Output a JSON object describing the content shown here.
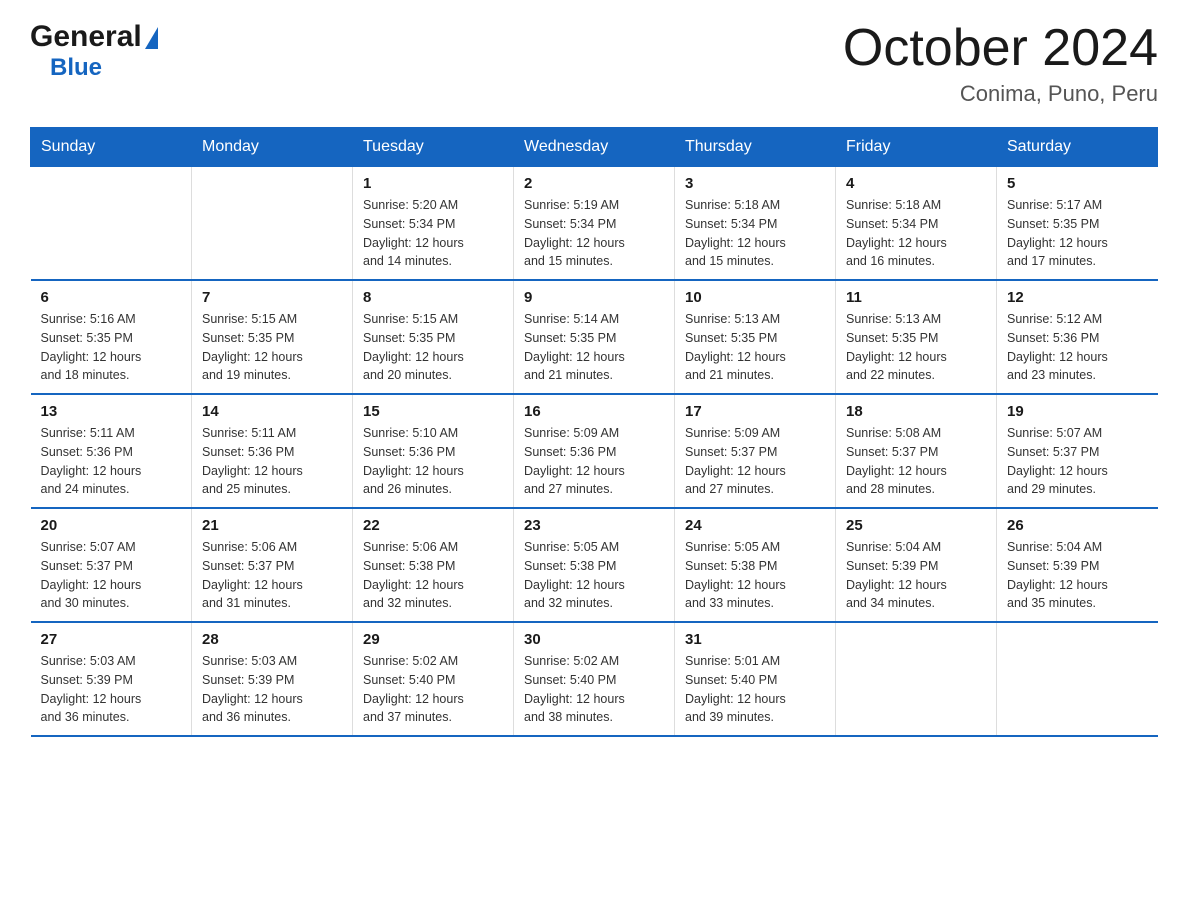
{
  "logo": {
    "general": "General",
    "blue": "Blue"
  },
  "title": "October 2024",
  "subtitle": "Conima, Puno, Peru",
  "headers": [
    "Sunday",
    "Monday",
    "Tuesday",
    "Wednesday",
    "Thursday",
    "Friday",
    "Saturday"
  ],
  "weeks": [
    [
      {
        "day": "",
        "info": ""
      },
      {
        "day": "",
        "info": ""
      },
      {
        "day": "1",
        "info": "Sunrise: 5:20 AM\nSunset: 5:34 PM\nDaylight: 12 hours\nand 14 minutes."
      },
      {
        "day": "2",
        "info": "Sunrise: 5:19 AM\nSunset: 5:34 PM\nDaylight: 12 hours\nand 15 minutes."
      },
      {
        "day": "3",
        "info": "Sunrise: 5:18 AM\nSunset: 5:34 PM\nDaylight: 12 hours\nand 15 minutes."
      },
      {
        "day": "4",
        "info": "Sunrise: 5:18 AM\nSunset: 5:34 PM\nDaylight: 12 hours\nand 16 minutes."
      },
      {
        "day": "5",
        "info": "Sunrise: 5:17 AM\nSunset: 5:35 PM\nDaylight: 12 hours\nand 17 minutes."
      }
    ],
    [
      {
        "day": "6",
        "info": "Sunrise: 5:16 AM\nSunset: 5:35 PM\nDaylight: 12 hours\nand 18 minutes."
      },
      {
        "day": "7",
        "info": "Sunrise: 5:15 AM\nSunset: 5:35 PM\nDaylight: 12 hours\nand 19 minutes."
      },
      {
        "day": "8",
        "info": "Sunrise: 5:15 AM\nSunset: 5:35 PM\nDaylight: 12 hours\nand 20 minutes."
      },
      {
        "day": "9",
        "info": "Sunrise: 5:14 AM\nSunset: 5:35 PM\nDaylight: 12 hours\nand 21 minutes."
      },
      {
        "day": "10",
        "info": "Sunrise: 5:13 AM\nSunset: 5:35 PM\nDaylight: 12 hours\nand 21 minutes."
      },
      {
        "day": "11",
        "info": "Sunrise: 5:13 AM\nSunset: 5:35 PM\nDaylight: 12 hours\nand 22 minutes."
      },
      {
        "day": "12",
        "info": "Sunrise: 5:12 AM\nSunset: 5:36 PM\nDaylight: 12 hours\nand 23 minutes."
      }
    ],
    [
      {
        "day": "13",
        "info": "Sunrise: 5:11 AM\nSunset: 5:36 PM\nDaylight: 12 hours\nand 24 minutes."
      },
      {
        "day": "14",
        "info": "Sunrise: 5:11 AM\nSunset: 5:36 PM\nDaylight: 12 hours\nand 25 minutes."
      },
      {
        "day": "15",
        "info": "Sunrise: 5:10 AM\nSunset: 5:36 PM\nDaylight: 12 hours\nand 26 minutes."
      },
      {
        "day": "16",
        "info": "Sunrise: 5:09 AM\nSunset: 5:36 PM\nDaylight: 12 hours\nand 27 minutes."
      },
      {
        "day": "17",
        "info": "Sunrise: 5:09 AM\nSunset: 5:37 PM\nDaylight: 12 hours\nand 27 minutes."
      },
      {
        "day": "18",
        "info": "Sunrise: 5:08 AM\nSunset: 5:37 PM\nDaylight: 12 hours\nand 28 minutes."
      },
      {
        "day": "19",
        "info": "Sunrise: 5:07 AM\nSunset: 5:37 PM\nDaylight: 12 hours\nand 29 minutes."
      }
    ],
    [
      {
        "day": "20",
        "info": "Sunrise: 5:07 AM\nSunset: 5:37 PM\nDaylight: 12 hours\nand 30 minutes."
      },
      {
        "day": "21",
        "info": "Sunrise: 5:06 AM\nSunset: 5:37 PM\nDaylight: 12 hours\nand 31 minutes."
      },
      {
        "day": "22",
        "info": "Sunrise: 5:06 AM\nSunset: 5:38 PM\nDaylight: 12 hours\nand 32 minutes."
      },
      {
        "day": "23",
        "info": "Sunrise: 5:05 AM\nSunset: 5:38 PM\nDaylight: 12 hours\nand 32 minutes."
      },
      {
        "day": "24",
        "info": "Sunrise: 5:05 AM\nSunset: 5:38 PM\nDaylight: 12 hours\nand 33 minutes."
      },
      {
        "day": "25",
        "info": "Sunrise: 5:04 AM\nSunset: 5:39 PM\nDaylight: 12 hours\nand 34 minutes."
      },
      {
        "day": "26",
        "info": "Sunrise: 5:04 AM\nSunset: 5:39 PM\nDaylight: 12 hours\nand 35 minutes."
      }
    ],
    [
      {
        "day": "27",
        "info": "Sunrise: 5:03 AM\nSunset: 5:39 PM\nDaylight: 12 hours\nand 36 minutes."
      },
      {
        "day": "28",
        "info": "Sunrise: 5:03 AM\nSunset: 5:39 PM\nDaylight: 12 hours\nand 36 minutes."
      },
      {
        "day": "29",
        "info": "Sunrise: 5:02 AM\nSunset: 5:40 PM\nDaylight: 12 hours\nand 37 minutes."
      },
      {
        "day": "30",
        "info": "Sunrise: 5:02 AM\nSunset: 5:40 PM\nDaylight: 12 hours\nand 38 minutes."
      },
      {
        "day": "31",
        "info": "Sunrise: 5:01 AM\nSunset: 5:40 PM\nDaylight: 12 hours\nand 39 minutes."
      },
      {
        "day": "",
        "info": ""
      },
      {
        "day": "",
        "info": ""
      }
    ]
  ]
}
